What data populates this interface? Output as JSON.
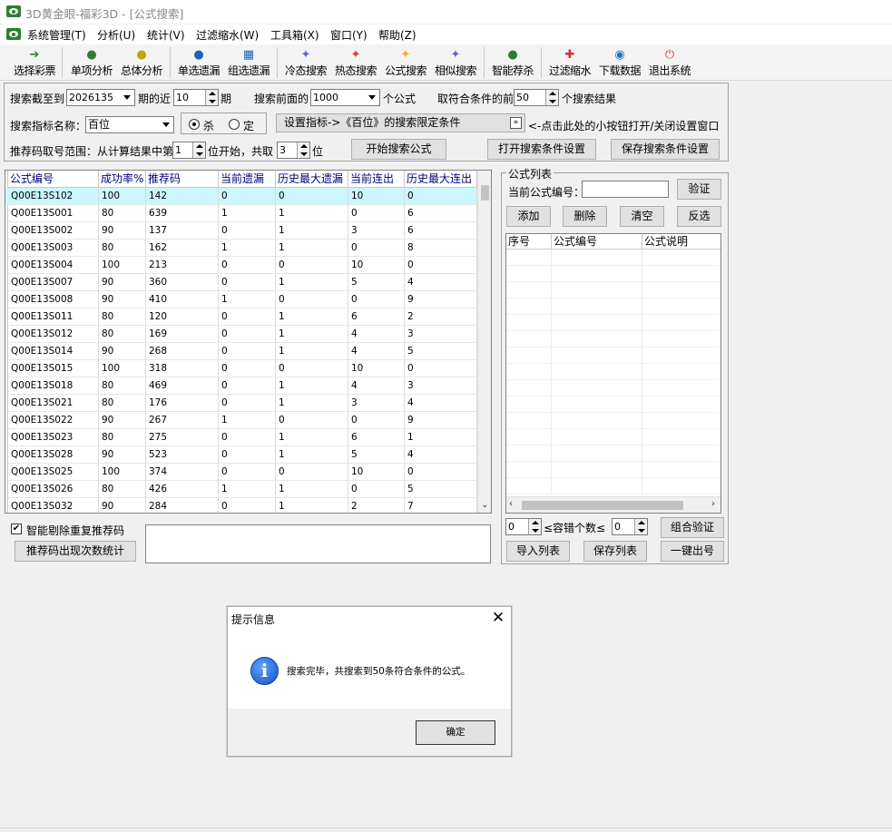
{
  "window": {
    "title": "3D黄金眼-福彩3D - [公式搜索]"
  },
  "menu": [
    {
      "label": "系统管理(T)"
    },
    {
      "label": "分析(U)"
    },
    {
      "label": "统计(V)"
    },
    {
      "label": "过滤缩水(W)"
    },
    {
      "label": "工具箱(X)"
    },
    {
      "label": "窗口(Y)"
    },
    {
      "label": "帮助(Z)"
    }
  ],
  "toolbar": [
    {
      "label": "选择彩票",
      "icon": "select-lottery-icon",
      "glyph": "➔",
      "color": "#1b8a2e"
    },
    {
      "label": "单项分析",
      "icon": "people-icon",
      "glyph": "●",
      "color": "#2e7d32"
    },
    {
      "label": "总体分析",
      "icon": "group-icon",
      "glyph": "●",
      "color": "#c9a300"
    },
    {
      "label": "单选遗漏",
      "icon": "user-icon",
      "glyph": "●",
      "color": "#1565c0"
    },
    {
      "label": "组选遗漏",
      "icon": "table-icon",
      "glyph": "▦",
      "color": "#1565c0"
    },
    {
      "label": "冷态搜索",
      "icon": "cold-search-icon",
      "glyph": "✦",
      "color": "#5c6bc0"
    },
    {
      "label": "热态搜索",
      "icon": "hot-search-icon",
      "glyph": "✦",
      "color": "#e53935"
    },
    {
      "label": "公式搜索",
      "icon": "formula-search-icon",
      "glyph": "✦",
      "color": "#f9a825"
    },
    {
      "label": "相似搜索",
      "icon": "similar-search-icon",
      "glyph": "✦",
      "color": "#7e57c2"
    },
    {
      "label": "智能荐杀",
      "icon": "smart-kill-icon",
      "glyph": "●",
      "color": "#2e7d32"
    },
    {
      "label": "过滤缩水",
      "icon": "filter-icon",
      "glyph": "✚",
      "color": "#d32f2f"
    },
    {
      "label": "下载数据",
      "icon": "download-globe-icon",
      "glyph": "◉",
      "color": "#1976d2"
    },
    {
      "label": "退出系统",
      "icon": "exit-icon",
      "glyph": "⏻",
      "color": "#e53935"
    }
  ],
  "search": {
    "until_label": "搜索截至到",
    "until_value": "2026135",
    "recent_label": "期的近",
    "recent_value": "10",
    "period_label": "期",
    "front_label": "搜索前面的",
    "front_value": "1000",
    "formula_label": "个公式",
    "take_label": "取符合条件的前",
    "take_value": "50",
    "result_label": "个搜索结果",
    "index_label": "搜索指标名称：",
    "index_value": "百位",
    "radio_kill": "杀",
    "radio_fix": "定",
    "set_index_button": "设置指标->《百位》的搜索限定条件",
    "toggle_hint": "<-点击此处的小按钮打开/关闭设置窗口",
    "range_label": "推荐码取号范围：从计算结果中第",
    "range_start": "1",
    "range_mid": "位开始，共取",
    "range_count": "3",
    "range_unit": "位",
    "start_button": "开始搜索公式",
    "open_settings_button": "打开搜索条件设置",
    "save_settings_button": "保存搜索条件设置"
  },
  "grid": {
    "headers": [
      "公式编号",
      "成功率%",
      "推荐码",
      "当前遗漏",
      "历史最大遗漏",
      "当前连出",
      "历史最大连出"
    ],
    "rows": [
      [
        "Q00E13S102",
        "100",
        "142",
        "0",
        "0",
        "10",
        "0"
      ],
      [
        "Q00E13S001",
        "80",
        "639",
        "1",
        "1",
        "0",
        "6"
      ],
      [
        "Q00E13S002",
        "90",
        "137",
        "0",
        "1",
        "3",
        "6"
      ],
      [
        "Q00E13S003",
        "80",
        "162",
        "1",
        "1",
        "0",
        "8"
      ],
      [
        "Q00E13S004",
        "100",
        "213",
        "0",
        "0",
        "10",
        "0"
      ],
      [
        "Q00E13S007",
        "90",
        "360",
        "0",
        "1",
        "5",
        "4"
      ],
      [
        "Q00E13S008",
        "90",
        "410",
        "1",
        "0",
        "0",
        "9"
      ],
      [
        "Q00E13S011",
        "80",
        "120",
        "0",
        "1",
        "6",
        "2"
      ],
      [
        "Q00E13S012",
        "80",
        "169",
        "0",
        "1",
        "4",
        "3"
      ],
      [
        "Q00E13S014",
        "90",
        "268",
        "0",
        "1",
        "4",
        "5"
      ],
      [
        "Q00E13S015",
        "100",
        "318",
        "0",
        "0",
        "10",
        "0"
      ],
      [
        "Q00E13S018",
        "80",
        "469",
        "0",
        "1",
        "4",
        "3"
      ],
      [
        "Q00E13S021",
        "80",
        "176",
        "0",
        "1",
        "3",
        "4"
      ],
      [
        "Q00E13S022",
        "90",
        "267",
        "1",
        "0",
        "0",
        "9"
      ],
      [
        "Q00E13S023",
        "80",
        "275",
        "0",
        "1",
        "6",
        "1"
      ],
      [
        "Q00E13S028",
        "90",
        "523",
        "0",
        "1",
        "5",
        "4"
      ],
      [
        "Q00E13S025",
        "100",
        "374",
        "0",
        "0",
        "10",
        "0"
      ],
      [
        "Q00E13S026",
        "80",
        "426",
        "1",
        "1",
        "0",
        "5"
      ],
      [
        "Q00E13S032",
        "90",
        "284",
        "0",
        "1",
        "2",
        "7"
      ]
    ]
  },
  "bottom_left": {
    "dedupe_label": "智能剔除重复推荐码",
    "dedupe_checked": "✔",
    "stats_button": "推荐码出现次数统计"
  },
  "formula_list": {
    "group_title": "公式列表",
    "current_label": "当前公式编号：",
    "current_value": "",
    "verify_button": "验证",
    "add_button": "添加",
    "delete_button": "删除",
    "clear_button": "清空",
    "invert_button": "反选",
    "headers": [
      "序号",
      "公式编号",
      "公式说明"
    ],
    "tolerance_min": "0",
    "tolerance_label": "≤容错个数≤",
    "tolerance_max": "0",
    "combo_verify_button": "组合验证",
    "import_button": "导入列表",
    "save_list_button": "保存列表",
    "quick_pick_button": "一键出号"
  },
  "dialog": {
    "title": "提示信息",
    "message": "搜索完毕，共搜索到50条符合条件的公式。",
    "ok_button": "确定"
  }
}
